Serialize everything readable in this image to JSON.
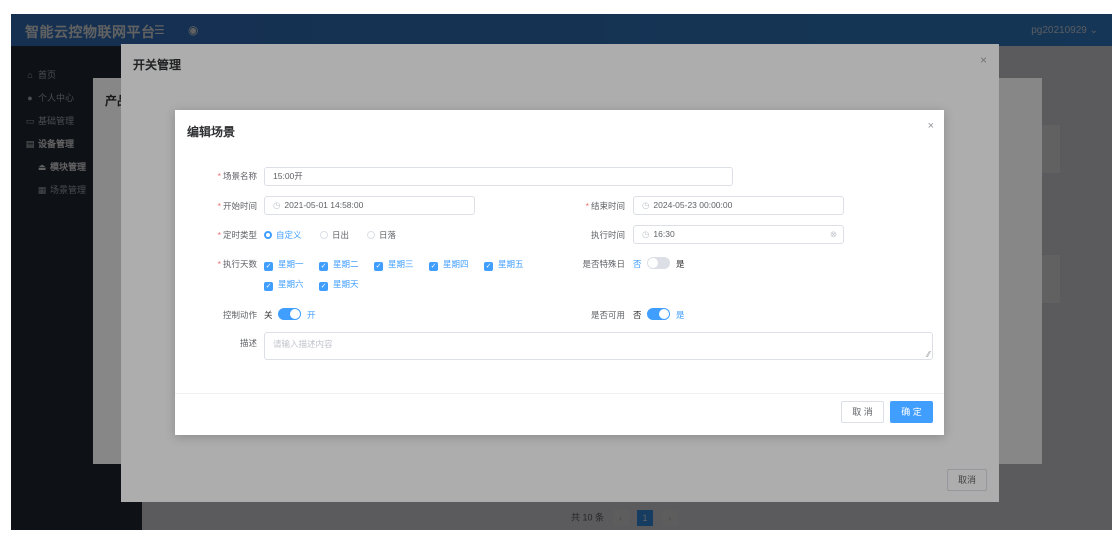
{
  "app": {
    "title": "智能云控物联网平台",
    "user": "pg20210929"
  },
  "sidebar": {
    "items": [
      {
        "label": "首页"
      },
      {
        "label": "个人中心"
      },
      {
        "label": "基础管理"
      },
      {
        "label": "设备管理"
      },
      {
        "label": "模块管理"
      },
      {
        "label": "场景管理"
      }
    ]
  },
  "pager": {
    "total": "共 10 条",
    "page": "1"
  },
  "product_dialog": {
    "title": "产品"
  },
  "switch_dialog": {
    "title": "开关管理",
    "cancel_label": "取消"
  },
  "edit_dialog": {
    "title": "编辑场景",
    "scene_name": {
      "label": "场景名称",
      "value": "15:00开"
    },
    "start_time": {
      "label": "开始时间",
      "value": "2021-05-01 14:58:00"
    },
    "end_time": {
      "label": "结束时间",
      "value": "2024-05-23 00:00:00"
    },
    "timing_type": {
      "label": "定时类型",
      "options": [
        "自定义",
        "日出",
        "日落"
      ],
      "selected": "自定义"
    },
    "exec_time": {
      "label": "执行时间",
      "value": "16:30"
    },
    "exec_days": {
      "label": "执行天数",
      "options": [
        "星期一",
        "星期二",
        "星期三",
        "星期四",
        "星期五",
        "星期六",
        "星期天"
      ]
    },
    "special_day": {
      "label": "是否特殊日",
      "off_text": "否",
      "on_text": "是",
      "value": false
    },
    "control_action": {
      "label": "控制动作",
      "off_text": "关",
      "on_text": "开",
      "value": true
    },
    "enabled": {
      "label": "是否可用",
      "off_text": "否",
      "on_text": "是",
      "value": true
    },
    "description": {
      "label": "描述",
      "placeholder": "请输入描述内容"
    },
    "cancel_label": "取 消",
    "confirm_label": "确 定"
  },
  "colors": {
    "primary": "#409eff",
    "topbar": "#3a8ee6",
    "sidebar": "#28313f"
  }
}
